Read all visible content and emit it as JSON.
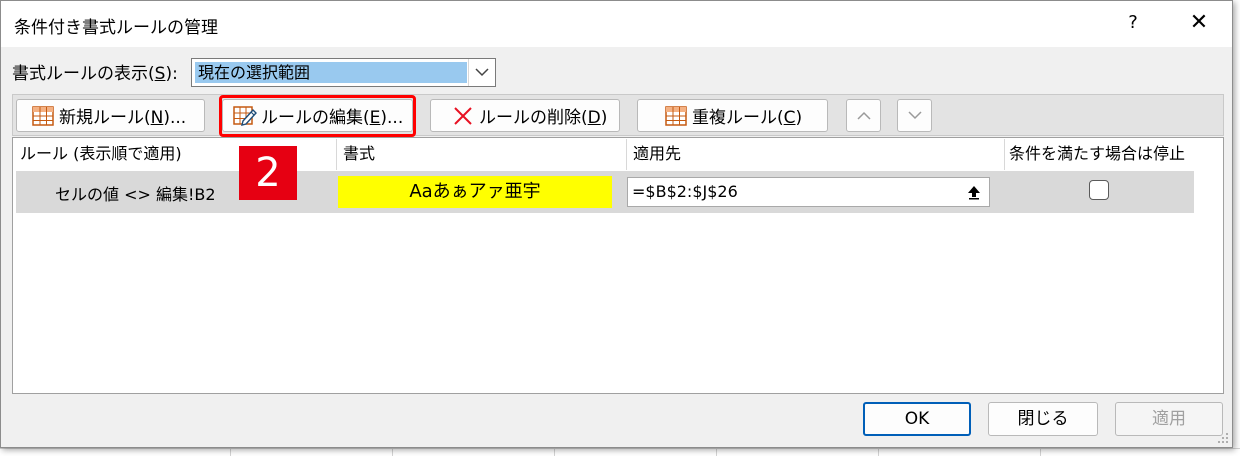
{
  "dialog": {
    "title": "条件付き書式ルールの管理",
    "help_label": "?",
    "close_label": "✕"
  },
  "show_rules": {
    "label_prefix": "書式ルールの表示(",
    "label_key": "S",
    "label_suffix": "):",
    "selected": "現在の選択範囲"
  },
  "toolbar": {
    "new_rule": {
      "prefix": "新規ルール(",
      "key": "N",
      "suffix": ")..."
    },
    "edit_rule": {
      "prefix": "ルールの編集(",
      "key": "E",
      "suffix": ")..."
    },
    "delete_rule": {
      "prefix": "ルールの削除(",
      "key": "D",
      "suffix": ")"
    },
    "duplicate_rule": {
      "prefix": "重複ルール(",
      "key": "C",
      "suffix": ")"
    }
  },
  "table": {
    "headers": {
      "rule": "ルール (表示順で適用)",
      "format": "書式",
      "applies_to": "適用先",
      "stop_if_true": "条件を満たす場合は停止"
    },
    "rows": [
      {
        "rule": "セルの値 <> 編集!B2",
        "format_preview": "Aaあぁアァ亜宇",
        "applies_to": "=$B$2:$J$26",
        "stop_if_true": false
      }
    ]
  },
  "annotation": {
    "step_number": "2"
  },
  "buttons": {
    "ok": "OK",
    "close": "閉じる",
    "apply": "適用"
  },
  "colors": {
    "highlight_red": "#ff0000",
    "badge_red": "#e60012",
    "format_fill": "#ffff00",
    "selection_blue": "#99c9ef"
  }
}
